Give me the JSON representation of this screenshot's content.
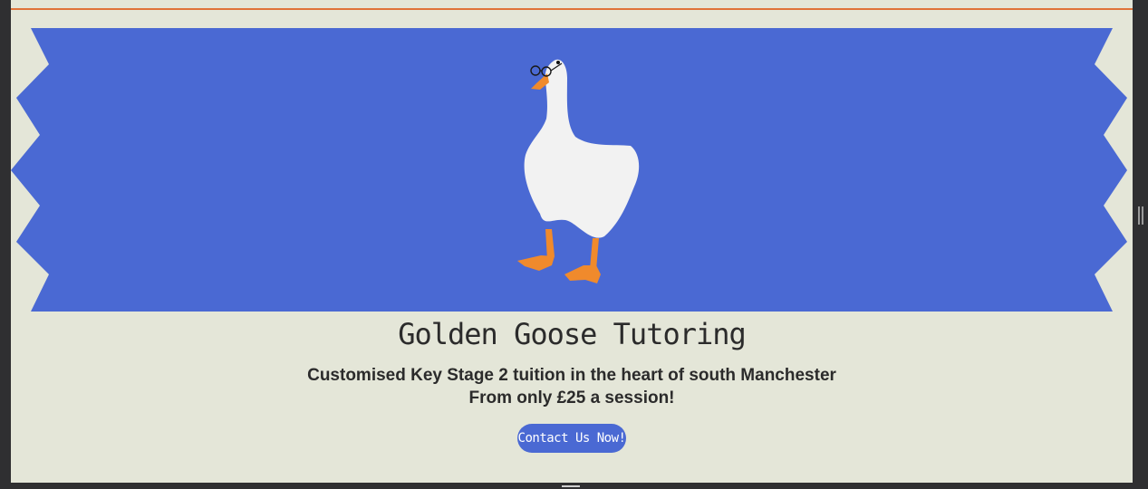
{
  "hero": {
    "title": "Golden Goose Tutoring",
    "tagline_line1": "Customised Key Stage 2 tuition in the heart of south Manchester",
    "tagline_line2": "From only £25 a session!",
    "cta_label": "Contact Us Now!"
  },
  "icons": {
    "banner_image": "goose-with-glasses-icon",
    "window_grip": "resize-grip-icon"
  },
  "colors": {
    "page_background": "#e4e6d8",
    "banner_blue": "#4a69d3",
    "accent_orange": "#e0733a",
    "goose_white": "#f2f2f2",
    "goose_orange": "#f08a2c",
    "text_dark": "#2b2b2b",
    "frame_dark": "#2f2f31"
  }
}
